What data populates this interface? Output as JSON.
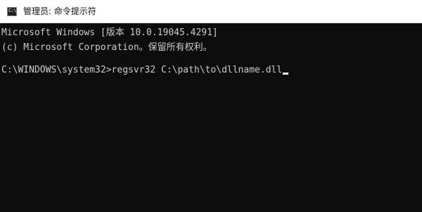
{
  "window": {
    "title": "管理员: 命令提示符",
    "icon": "cmd-console-icon",
    "icon_glyph": "C:\\",
    "background_color": "#0c0c0c",
    "text_color": "#cccccc"
  },
  "console": {
    "lines": [
      "Microsoft Windows [版本 10.0.19045.4291]",
      "(c) Microsoft Corporation。保留所有权利。"
    ],
    "prompt": "C:\\WINDOWS\\system32>",
    "command": "regsvr32 C:\\path\\to\\dllname.dll"
  }
}
